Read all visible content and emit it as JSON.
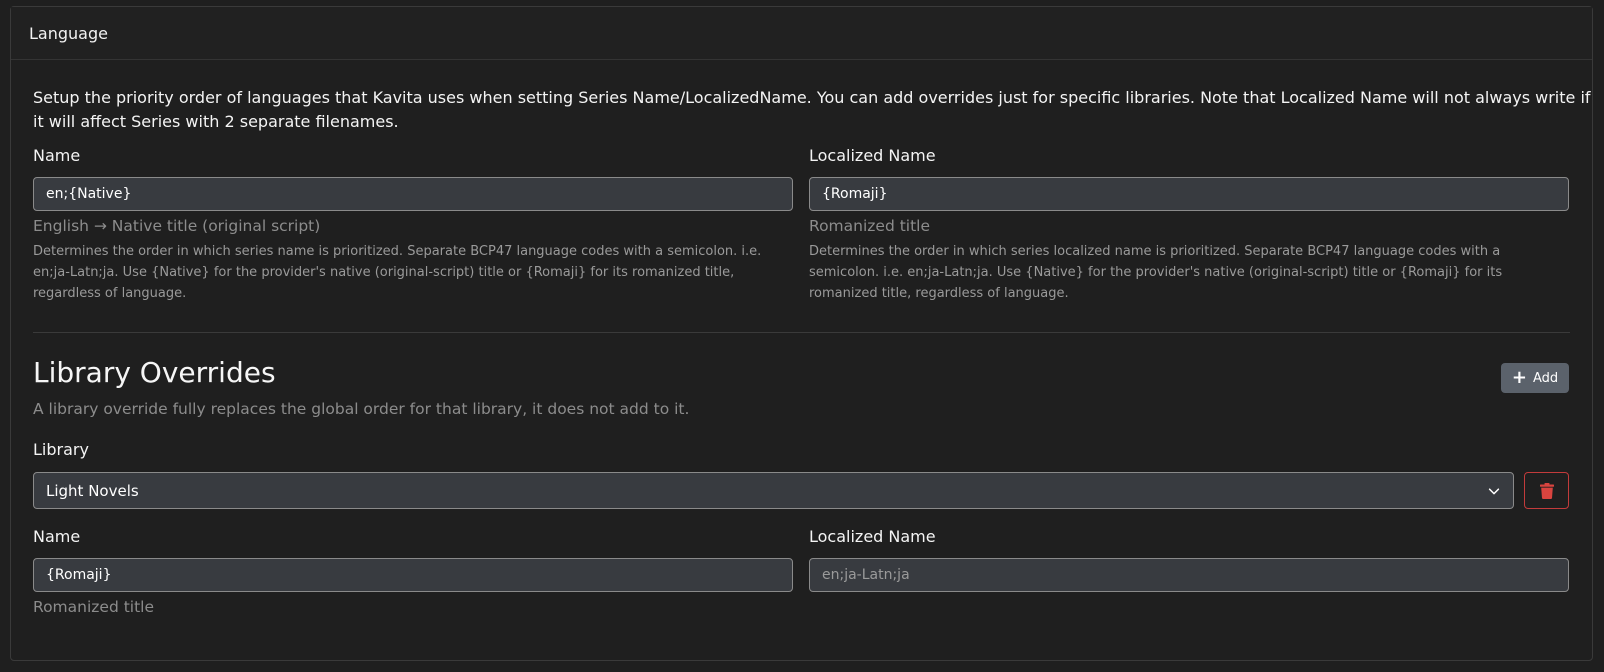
{
  "header": {
    "title": "Language"
  },
  "description": "Setup the priority order of languages that Kavita uses when setting Series Name/LocalizedName. You can add overrides just for specific libraries. Note that Localized Name will not always write if it will affect Series with 2 separate filenames.",
  "global": {
    "name": {
      "label": "Name",
      "value": "en;{Native}",
      "hint": "English → Native title (original script)",
      "help": "Determines the order in which series name is prioritized. Separate BCP47 language codes with a semicolon. i.e. en;ja-Latn;ja. Use {Native} for the provider's native (original-script) title or {Romaji} for its romanized title, regardless of language."
    },
    "localized": {
      "label": "Localized Name",
      "value": "{Romaji}",
      "hint": "Romanized title",
      "help": "Determines the order in which series localized name is prioritized. Separate BCP47 language codes with a semicolon. i.e. en;ja-Latn;ja. Use {Native} for the provider's native (original-script) title or {Romaji} for its romanized title, regardless of language."
    }
  },
  "overrides": {
    "title": "Library Overrides",
    "subtitle": "A library override fully replaces the global order for that library, it does not add to it.",
    "add_label": "Add",
    "library_label": "Library",
    "library_selected": "Light Novels",
    "name": {
      "label": "Name",
      "value": "{Romaji}",
      "hint": "Romanized title"
    },
    "localized": {
      "label": "Localized Name",
      "placeholder": "en;ja-Latn;ja"
    }
  },
  "icons": {
    "add": "plus-icon",
    "select": "chevron-down-icon",
    "delete": "trash-icon"
  },
  "colors": {
    "background": "#1f1f1f",
    "input_bg": "#383b40",
    "add_button": "#5b626b",
    "danger": "#c23b3b"
  }
}
